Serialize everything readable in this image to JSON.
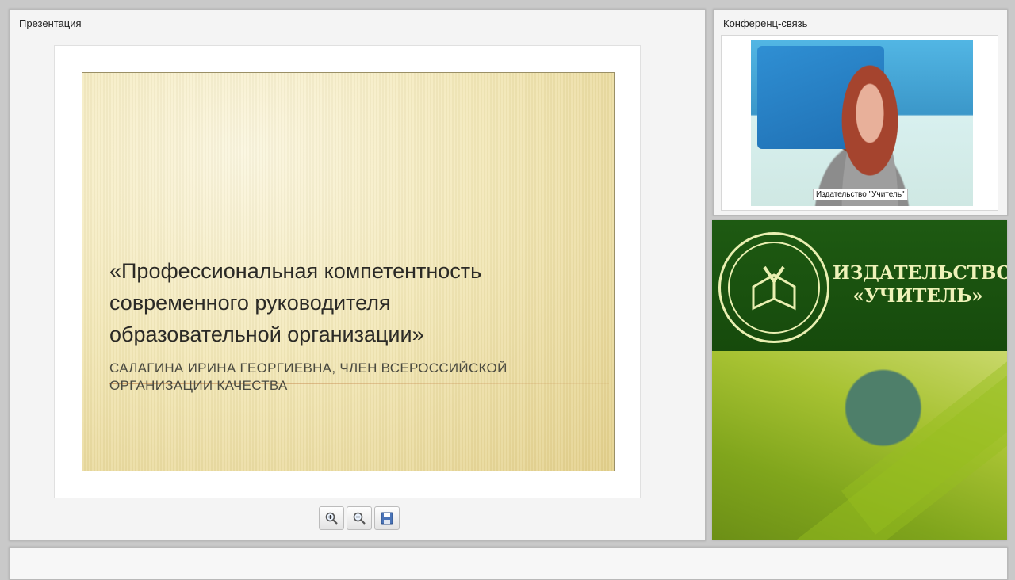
{
  "presentation": {
    "title": "Презентация",
    "slide": {
      "title": "«Профессиональная компетентность\nсовременного руководителя\nобразовательной организации»",
      "subtitle": "Салагина Ирина Георгиевна, член Всероссийской организации качества"
    },
    "toolbar": {
      "zoom_in_icon": "zoom-in-icon",
      "zoom_out_icon": "zoom-out-icon",
      "save_icon": "save-icon"
    }
  },
  "conference": {
    "title": "Конференц-связь",
    "participant_name": "Издательство \"Учитель\""
  },
  "brand": {
    "name": "ИЗДАТЕЛЬСТВО\n«УЧИТЕЛЬ»",
    "colors": {
      "green": "#1e5a12",
      "text": "#eef2b8"
    }
  }
}
